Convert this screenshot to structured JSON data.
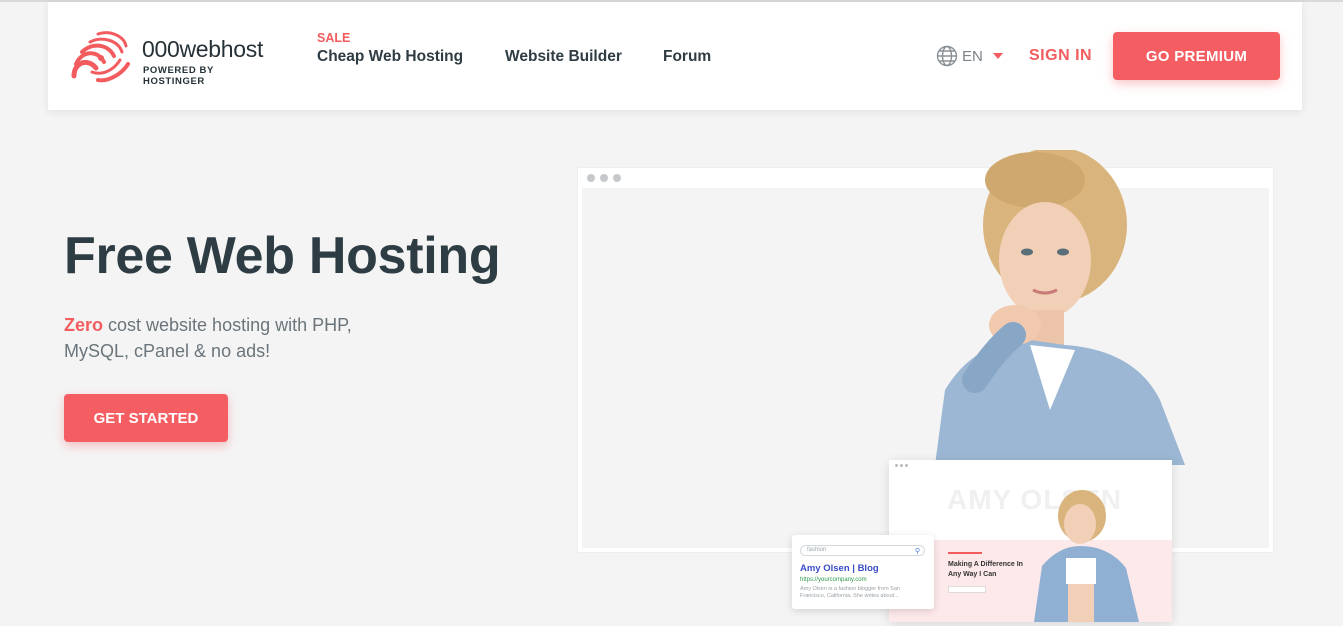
{
  "brand": {
    "name": "000webhost",
    "tagline": "POWERED BY HOSTINGER",
    "accent_color": "#f45d61"
  },
  "nav": {
    "sale_badge": "SALE",
    "items": [
      {
        "label": "Cheap Web Hosting"
      },
      {
        "label": "Website Builder"
      },
      {
        "label": "Forum"
      }
    ],
    "language": "EN",
    "language_icon": "globe-icon",
    "sign_in": "SIGN IN",
    "premium": "GO PREMIUM"
  },
  "hero": {
    "title": "Free Web Hosting",
    "subtitle_highlight": "Zero",
    "subtitle_rest": " cost website hosting with PHP, MySQL, cPanel & no ads!",
    "cta": "GET STARTED"
  },
  "mockup": {
    "site_name": "AMY OLSEN",
    "site_heading": "Making A Difference In Any Way I Can",
    "search_placeholder": "fashion",
    "result_title": "Amy Olsen | Blog",
    "result_url": "https://yourcompany.com",
    "result_desc": "Amy Olsen is a fashion blogger from San Francisco, California. She writes about..."
  }
}
